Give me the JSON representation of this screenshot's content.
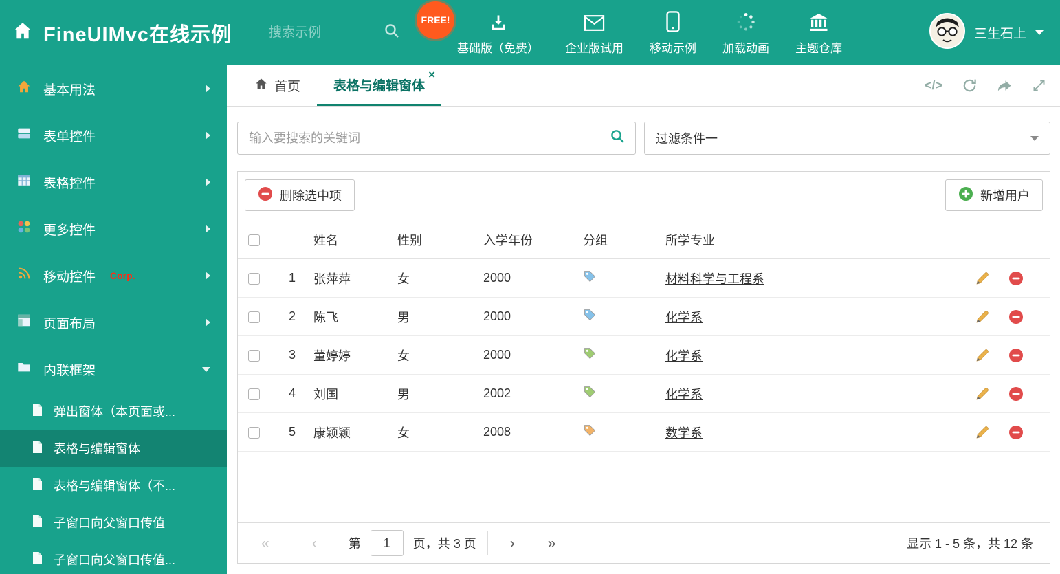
{
  "colors": {
    "brand_teal": "#18A28C",
    "active_tab_teal": "#10836F",
    "badge_orange": "#FF5A1E",
    "delete_red": "#E14B4B",
    "add_green": "#4CAF50",
    "pencil_orange": "#EBB24A"
  },
  "header": {
    "title": "FineUIMvc在线示例",
    "search_placeholder": "搜索示例",
    "free_badge": "FREE!",
    "nav_items": [
      {
        "label": "基础版（免费）"
      },
      {
        "label": "企业版试用"
      },
      {
        "label": "移动示例"
      },
      {
        "label": "加载动画"
      },
      {
        "label": "主题仓库"
      }
    ],
    "user_name": "三生石上"
  },
  "sidebar": {
    "items": [
      {
        "label": "基本用法"
      },
      {
        "label": "表单控件"
      },
      {
        "label": "表格控件"
      },
      {
        "label": "更多控件"
      },
      {
        "label": "移动控件",
        "badge": "Corp."
      },
      {
        "label": "页面布局"
      },
      {
        "label": "内联框架"
      }
    ],
    "subitems": [
      {
        "label": "弹出窗体（本页面或..."
      },
      {
        "label": "表格与编辑窗体"
      },
      {
        "label": "表格与编辑窗体（不..."
      },
      {
        "label": "子窗口向父窗口传值"
      },
      {
        "label": "子窗口向父窗口传值..."
      }
    ]
  },
  "tabs": {
    "home_label": "首页",
    "active_label": "表格与编辑窗体",
    "close_glyph": "×"
  },
  "tab_tools": {
    "code_label": "</>"
  },
  "filter": {
    "search_placeholder": "输入要搜索的关键词",
    "dropdown_value": "过滤条件一"
  },
  "toolbar": {
    "delete_label": "删除选中项",
    "add_label": "新增用户"
  },
  "table": {
    "headers": {
      "name": "姓名",
      "gender": "性别",
      "year": "入学年份",
      "group": "分组",
      "major": "所学专业"
    },
    "rows": [
      {
        "num": "1",
        "name": "张萍萍",
        "gender": "女",
        "year": "2000",
        "tag_color": "#85C2EA",
        "major": "材料科学与工程系"
      },
      {
        "num": "2",
        "name": "陈飞",
        "gender": "男",
        "year": "2000",
        "tag_color": "#85C2EA",
        "major": "化学系"
      },
      {
        "num": "3",
        "name": "董婷婷",
        "gender": "女",
        "year": "2000",
        "tag_color": "#9FCC72",
        "major": "化学系"
      },
      {
        "num": "4",
        "name": "刘国",
        "gender": "男",
        "year": "2002",
        "tag_color": "#9FCC72",
        "major": "化学系"
      },
      {
        "num": "5",
        "name": "康颖颖",
        "gender": "女",
        "year": "2008",
        "tag_color": "#F2B368",
        "major": "数学系"
      }
    ]
  },
  "pagination": {
    "first_glyph": "«",
    "prev_glyph": "‹",
    "label": "第",
    "page": "1",
    "suffix": "页，共 3 页",
    "next_glyph": "›",
    "last_glyph": "»",
    "summary": "显示 1 - 5 条，共 12 条"
  }
}
